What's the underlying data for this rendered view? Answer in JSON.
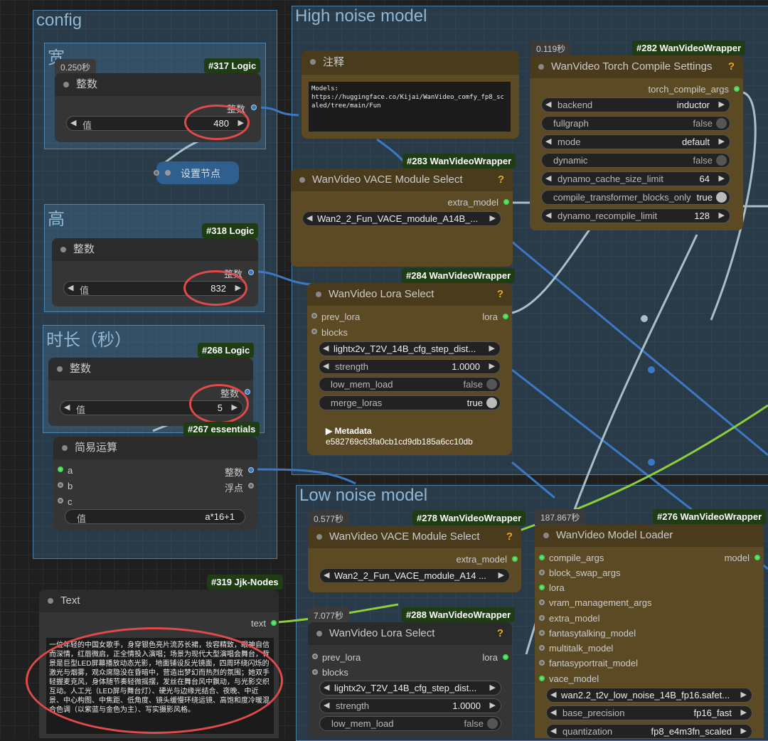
{
  "groups": {
    "config": "config",
    "width": "宽",
    "height": "高",
    "duration": "时长（秒）",
    "high_noise": "High noise model",
    "low_noise": "Low noise model"
  },
  "colors": {
    "badge": "#1e3d14",
    "circle": "#e04a4a",
    "wire_blue": "#3b79c4",
    "wire_green": "#8ccf3a",
    "wire_gray": "#a8bfc4"
  },
  "nodes": {
    "n317": {
      "timing": "0.250秒",
      "badge": "#317 Logic",
      "title": "整数",
      "output": "整数",
      "widget_label": "值",
      "widget_value": "480"
    },
    "n318": {
      "badge": "#318 Logic",
      "title": "整数",
      "output": "整数",
      "widget_label": "值",
      "widget_value": "832"
    },
    "n268": {
      "badge": "#268 Logic",
      "title": "整数",
      "output": "整数",
      "widget_label": "值",
      "widget_value": "5"
    },
    "n267": {
      "badge": "#267 essentials",
      "title": "简易运算",
      "in_a": "a",
      "in_b": "b",
      "in_c": "c",
      "out1": "整数",
      "out2": "浮点",
      "widget_label": "值",
      "widget_value": "a*16+1"
    },
    "setnode": {
      "label": "设置节点"
    },
    "n319": {
      "badge": "#319 Jjk-Nodes",
      "title": "Text",
      "output": "text",
      "text": "一位年轻的中国女歌手，身穿银色亮片流苏长裙，妆容精致，眼神自信而深情，红唇微启，正全情投入演唱；场景为现代大型演唱会舞台，背景是巨型LED屏幕播放动态光影，地面铺设反光镜面，四周环绕闪烁的激光与烟雾，观众席隐没在昏暗中，营造出梦幻而热烈的氛围；她双手轻握麦克风，身体随节奏轻微摇摆，发丝在舞台风中飘动，与光影交织互动。人工光（LED屏与舞台灯）、硬光与边缘光结合、夜晚、中近景、中心构图、中焦距、低角度、镜头缓慢环绕运镜、高饱和度冷暖混合色调（以紫蓝与金色为主）、写实摄影风格。"
    },
    "note": {
      "title": "注释",
      "text": "Models:\nhttps://huggingface.co/Kijai/WanVideo_comfy_fp8_scaled/tree/main/Fun"
    },
    "n282": {
      "timing": "0.119秒",
      "badge": "#282 WanVideoWrapper",
      "title": "WanVideo Torch Compile Settings",
      "output": "torch_compile_args",
      "w_backend_l": "backend",
      "w_backend_v": "inductor",
      "w_fullgraph_l": "fullgraph",
      "w_fullgraph_v": "false",
      "w_mode_l": "mode",
      "w_mode_v": "default",
      "w_dynamic_l": "dynamic",
      "w_dynamic_v": "false",
      "w_cache_l": "dynamo_cache_size_limit",
      "w_cache_v": "64",
      "w_ctbo_l": "compile_transformer_blocks_only",
      "w_ctbo_v": "true",
      "w_recomp_l": "dynamo_recompile_limit",
      "w_recomp_v": "128"
    },
    "n283": {
      "badge": "#283 WanVideoWrapper",
      "title": "WanVideo VACE Module Select",
      "output": "extra_model",
      "widget": "Wan2_2_Fun_VACE_module_A14B_..."
    },
    "n284": {
      "badge": "#284 WanVideoWrapper",
      "title": "WanVideo Lora Select",
      "in1": "prev_lora",
      "in2": "blocks",
      "output": "lora",
      "w_lora": "lightx2v_T2V_14B_cfg_step_dist...",
      "w_strength_l": "strength",
      "w_strength_v": "1.0000",
      "w_lowmem_l": "low_mem_load",
      "w_lowmem_v": "false",
      "w_merge_l": "merge_loras",
      "w_merge_v": "true",
      "meta_label": "▶ Metadata",
      "meta_value": "e582769c63fa0cb1cd9db185a6cc10db"
    },
    "n278": {
      "timing": "0.577秒",
      "badge": "#278 WanVideoWrapper",
      "title": "WanVideo VACE Module Select",
      "output": "extra_model",
      "widget": "Wan2_2_Fun_VACE_module_A14 ..."
    },
    "n288": {
      "timing": "7.077秒",
      "badge": "#288 WanVideoWrapper",
      "title": "WanVideo Lora Select",
      "in1": "prev_lora",
      "in2": "blocks",
      "output": "lora",
      "w_lora": "lightx2v_T2V_14B_cfg_step_dist...",
      "w_strength_l": "strength",
      "w_strength_v": "1.0000",
      "w_lowmem_l": "low_mem_load",
      "w_lowmem_v": "false"
    },
    "n276": {
      "timing": "187.867秒",
      "badge": "#276 WanVideoWrapper",
      "title": "WanVideo Model Loader",
      "output": "model",
      "inputs": [
        "compile_args",
        "block_swap_args",
        "lora",
        "vram_management_args",
        "extra_model",
        "fantasytalking_model",
        "multitalk_model",
        "fantasyportrait_model",
        "vace_model"
      ],
      "w_model": "wan2.2_t2v_low_noise_14B_fp16.safet...",
      "w_prec_l": "base_precision",
      "w_prec_v": "fp16_fast",
      "w_quant_l": "quantization",
      "w_quant_v": "fp8_e4m3fn_scaled"
    }
  }
}
